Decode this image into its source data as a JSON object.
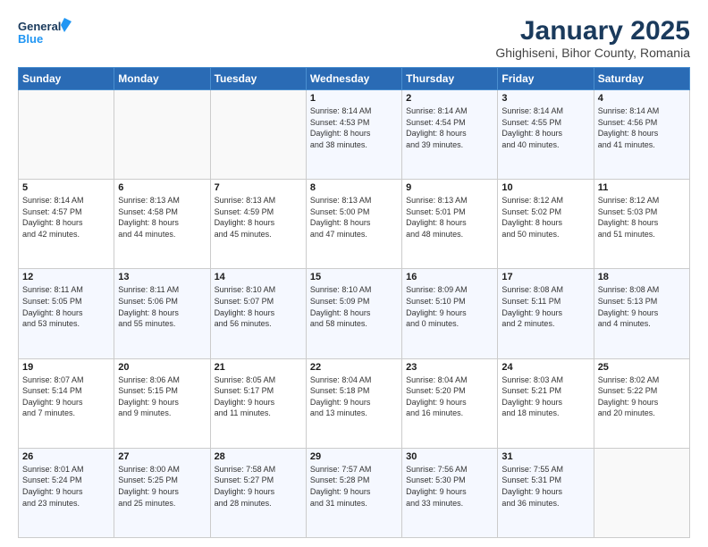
{
  "logo": {
    "line1": "General",
    "line2": "Blue"
  },
  "title": "January 2025",
  "subtitle": "Ghighiseni, Bihor County, Romania",
  "days_header": [
    "Sunday",
    "Monday",
    "Tuesday",
    "Wednesday",
    "Thursday",
    "Friday",
    "Saturday"
  ],
  "weeks": [
    [
      {
        "day": "",
        "text": ""
      },
      {
        "day": "",
        "text": ""
      },
      {
        "day": "",
        "text": ""
      },
      {
        "day": "1",
        "text": "Sunrise: 8:14 AM\nSunset: 4:53 PM\nDaylight: 8 hours\nand 38 minutes."
      },
      {
        "day": "2",
        "text": "Sunrise: 8:14 AM\nSunset: 4:54 PM\nDaylight: 8 hours\nand 39 minutes."
      },
      {
        "day": "3",
        "text": "Sunrise: 8:14 AM\nSunset: 4:55 PM\nDaylight: 8 hours\nand 40 minutes."
      },
      {
        "day": "4",
        "text": "Sunrise: 8:14 AM\nSunset: 4:56 PM\nDaylight: 8 hours\nand 41 minutes."
      }
    ],
    [
      {
        "day": "5",
        "text": "Sunrise: 8:14 AM\nSunset: 4:57 PM\nDaylight: 8 hours\nand 42 minutes."
      },
      {
        "day": "6",
        "text": "Sunrise: 8:13 AM\nSunset: 4:58 PM\nDaylight: 8 hours\nand 44 minutes."
      },
      {
        "day": "7",
        "text": "Sunrise: 8:13 AM\nSunset: 4:59 PM\nDaylight: 8 hours\nand 45 minutes."
      },
      {
        "day": "8",
        "text": "Sunrise: 8:13 AM\nSunset: 5:00 PM\nDaylight: 8 hours\nand 47 minutes."
      },
      {
        "day": "9",
        "text": "Sunrise: 8:13 AM\nSunset: 5:01 PM\nDaylight: 8 hours\nand 48 minutes."
      },
      {
        "day": "10",
        "text": "Sunrise: 8:12 AM\nSunset: 5:02 PM\nDaylight: 8 hours\nand 50 minutes."
      },
      {
        "day": "11",
        "text": "Sunrise: 8:12 AM\nSunset: 5:03 PM\nDaylight: 8 hours\nand 51 minutes."
      }
    ],
    [
      {
        "day": "12",
        "text": "Sunrise: 8:11 AM\nSunset: 5:05 PM\nDaylight: 8 hours\nand 53 minutes."
      },
      {
        "day": "13",
        "text": "Sunrise: 8:11 AM\nSunset: 5:06 PM\nDaylight: 8 hours\nand 55 minutes."
      },
      {
        "day": "14",
        "text": "Sunrise: 8:10 AM\nSunset: 5:07 PM\nDaylight: 8 hours\nand 56 minutes."
      },
      {
        "day": "15",
        "text": "Sunrise: 8:10 AM\nSunset: 5:09 PM\nDaylight: 8 hours\nand 58 minutes."
      },
      {
        "day": "16",
        "text": "Sunrise: 8:09 AM\nSunset: 5:10 PM\nDaylight: 9 hours\nand 0 minutes."
      },
      {
        "day": "17",
        "text": "Sunrise: 8:08 AM\nSunset: 5:11 PM\nDaylight: 9 hours\nand 2 minutes."
      },
      {
        "day": "18",
        "text": "Sunrise: 8:08 AM\nSunset: 5:13 PM\nDaylight: 9 hours\nand 4 minutes."
      }
    ],
    [
      {
        "day": "19",
        "text": "Sunrise: 8:07 AM\nSunset: 5:14 PM\nDaylight: 9 hours\nand 7 minutes."
      },
      {
        "day": "20",
        "text": "Sunrise: 8:06 AM\nSunset: 5:15 PM\nDaylight: 9 hours\nand 9 minutes."
      },
      {
        "day": "21",
        "text": "Sunrise: 8:05 AM\nSunset: 5:17 PM\nDaylight: 9 hours\nand 11 minutes."
      },
      {
        "day": "22",
        "text": "Sunrise: 8:04 AM\nSunset: 5:18 PM\nDaylight: 9 hours\nand 13 minutes."
      },
      {
        "day": "23",
        "text": "Sunrise: 8:04 AM\nSunset: 5:20 PM\nDaylight: 9 hours\nand 16 minutes."
      },
      {
        "day": "24",
        "text": "Sunrise: 8:03 AM\nSunset: 5:21 PM\nDaylight: 9 hours\nand 18 minutes."
      },
      {
        "day": "25",
        "text": "Sunrise: 8:02 AM\nSunset: 5:22 PM\nDaylight: 9 hours\nand 20 minutes."
      }
    ],
    [
      {
        "day": "26",
        "text": "Sunrise: 8:01 AM\nSunset: 5:24 PM\nDaylight: 9 hours\nand 23 minutes."
      },
      {
        "day": "27",
        "text": "Sunrise: 8:00 AM\nSunset: 5:25 PM\nDaylight: 9 hours\nand 25 minutes."
      },
      {
        "day": "28",
        "text": "Sunrise: 7:58 AM\nSunset: 5:27 PM\nDaylight: 9 hours\nand 28 minutes."
      },
      {
        "day": "29",
        "text": "Sunrise: 7:57 AM\nSunset: 5:28 PM\nDaylight: 9 hours\nand 31 minutes."
      },
      {
        "day": "30",
        "text": "Sunrise: 7:56 AM\nSunset: 5:30 PM\nDaylight: 9 hours\nand 33 minutes."
      },
      {
        "day": "31",
        "text": "Sunrise: 7:55 AM\nSunset: 5:31 PM\nDaylight: 9 hours\nand 36 minutes."
      },
      {
        "day": "",
        "text": ""
      }
    ]
  ]
}
